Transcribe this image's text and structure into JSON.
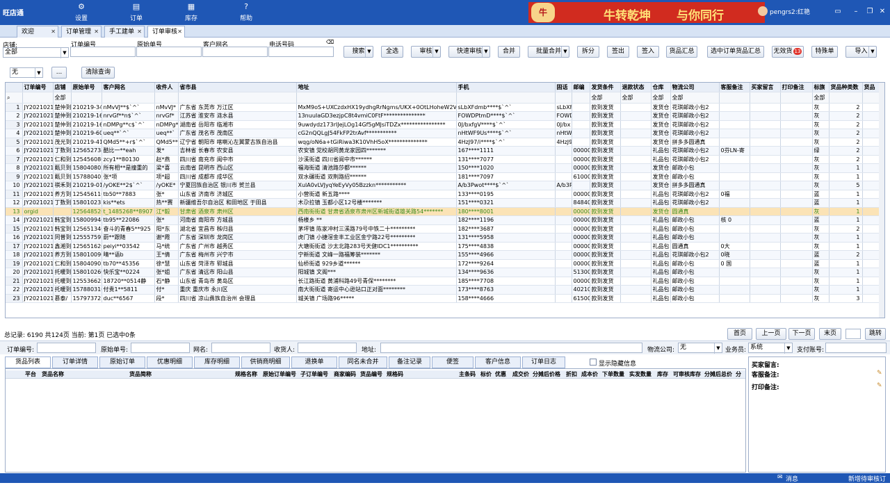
{
  "app": {
    "title": "旺店通",
    "nav": [
      {
        "label": "设置",
        "icon": "gear-icon"
      },
      {
        "label": "订单",
        "icon": "cart-icon"
      },
      {
        "label": "库存",
        "icon": "box-icon"
      },
      {
        "label": "帮助",
        "icon": "help-icon"
      }
    ],
    "banner_left": "牛转乾坤",
    "banner_right": "与你同行",
    "user": "pengrs2:红艳"
  },
  "tabs": [
    "欢迎",
    "订单管理",
    "手工建单",
    "订单审核"
  ],
  "filters": {
    "shop_label": "店铺:",
    "shop_value": "全部",
    "order_no": "订单编号",
    "original_no": "原始单号",
    "customer": "客户网名",
    "phone": "电话号码",
    "flag_value": "无",
    "more": "...",
    "clear": "清除查询"
  },
  "toolbar": [
    {
      "label": "搜索",
      "dd": true
    },
    {
      "label": "全选"
    },
    {
      "label": "审核",
      "dd": true
    },
    {
      "label": "快速审核",
      "dd": true
    },
    {
      "label": "合并"
    },
    {
      "label": "批量合并",
      "dd": true
    },
    {
      "label": "拆分"
    },
    {
      "label": "签出"
    },
    {
      "label": "签入"
    },
    {
      "label": "货品汇总"
    },
    {
      "label": "选中订单货品汇总"
    },
    {
      "label": "无效货",
      "badge": "13"
    },
    {
      "label": "特殊单"
    },
    {
      "label": "导入",
      "dd": true
    }
  ],
  "grid": {
    "headers": [
      "订单编号",
      "店铺",
      "原始单号",
      "客户网名",
      "收件人",
      "省市县",
      "地址",
      "手机",
      "固话",
      "邮编",
      "发货条件",
      "退款状态",
      "仓库",
      "物流公司",
      "客服备注",
      "买家留言",
      "打印备注",
      "标旗",
      "货品种类数",
      "货品"
    ],
    "filter_all": "全部",
    "rows": [
      [
        "1",
        "JY2021021",
        "楚仲到",
        "210219-34",
        "nMvVJ**$`^`",
        "nMvVJ*",
        "广东省 东莞市 万江区",
        "MxM9oS+UXCzdxHX19ydhgRrNgms/UKX+0OtLHoheW2VZJBkw",
        "sLbXFdmb****$`^`",
        "sLbXF",
        "",
        "款到发货",
        "",
        "发货仓",
        "花琪邮政小包2",
        "",
        "",
        "",
        "灰",
        "2"
      ],
      [
        "2",
        "JY2021021",
        "楚仲到",
        "210219-16",
        "nrvGf**n$`^`",
        "nrvGf*",
        "江苏省 淮安市 涟水县",
        "13nuuIaGD3ezjpC8t4vmiC0FtF***************",
        "FOWDPtmD****$`^`",
        "FOWDP",
        "",
        "款到发货",
        "",
        "发货仓",
        "花琪邮政小包2",
        "",
        "",
        "",
        "灰",
        "2"
      ],
      [
        "3",
        "JY2021021",
        "楚仲到",
        "210219-16",
        "nDMPg**c$`^`",
        "nDMPg*",
        "湖南省 岳阳市 临湘市",
        "9uwdydz173rIJejLOg14Gf5gMJsiTDZx****************",
        "0J/bxfgV****$`^`",
        "0J/bx",
        "",
        "款到发货",
        "",
        "发货仓",
        "花琪邮政小包2",
        "",
        "",
        "",
        "灰",
        "2"
      ],
      [
        "4",
        "JY2021021",
        "楚仲到",
        "210219-60",
        "ueq**`^`",
        "ueq**`",
        "广东省 茂名市 茂南区",
        "cG2nQQLgJ54FkFP2trAvf***********",
        "nHtWF9Us****$`^`",
        "nHtWF",
        "",
        "款到发货",
        "",
        "发货仓",
        "花琪邮政小包2",
        "",
        "",
        "",
        "灰",
        "2"
      ],
      [
        "5",
        "JY2021021",
        "茂光到",
        "210219-41",
        "QMd5**+r$`^`",
        "QMd5**",
        "辽宁省 朝阳市 喀喇沁左翼蒙古族自治县",
        "wqg/oN6a+tGiRiwa3K10VhH5oX**************",
        "4HzJ97/i****$`^`",
        "4HzJ9",
        "",
        "款到发货",
        "",
        "发货仓",
        "拼多多圆通真",
        "",
        "",
        "",
        "灰",
        "2"
      ],
      [
        "6",
        "JY2021021",
        "丁数到",
        "125652734",
        "酷比一**eah",
        "发*",
        "吉林省 长春市 农安县",
        "农安镇 党校胡同黄龙家园四*******",
        "167****1111",
        "",
        "00000",
        "款到发货",
        "",
        "礼品包",
        "花琪邮政小包2",
        "0芬LN-寄",
        "",
        "",
        "绿",
        "2"
      ],
      [
        "7",
        "JY2021021",
        "仁和到",
        "125456080",
        "zcy1**80130",
        "赵*燕",
        "四川省 南充市 阆中市",
        "沙溪街道 四川省阆中市******",
        "131****7077",
        "",
        "00000",
        "款到发货",
        "",
        "礼品包",
        "花琪邮政小包2",
        "",
        "",
        "",
        "灰",
        "2"
      ],
      [
        "8",
        "JY2021021",
        "甄贝到",
        "158040802",
        "所有相**是撞重的",
        "梁*喜",
        "云南省 昆明市 西山区",
        "福海街道 清池路莎都******",
        "150****1020",
        "",
        "00000",
        "款到发货",
        "",
        "发货仓",
        "邮政小包",
        "",
        "",
        "",
        "灰",
        "1"
      ],
      [
        "9",
        "JY2021021",
        "甄贝到",
        "157880401",
        "张*项",
        "项*超",
        "四川省 成都市 成华区",
        "双水碾街道 双荆路招******",
        "181****7097",
        "",
        "61000",
        "款到发货",
        "",
        "发货仓",
        "邮政小包",
        "",
        "",
        "",
        "灰",
        "1"
      ],
      [
        "10",
        "JY2021021",
        "祺禾到",
        "210219-01",
        "/yOKE**2$`^`",
        "/yOKE*",
        "宁夏回族自治区 银川市 贺兰县",
        "XulA0vLVJyqYeEyVy05Bzzkn***********",
        "A/b3Pwot****$`^`",
        "A/b3P",
        "",
        "款到发货",
        "",
        "发货仓",
        "拼多多圆通真",
        "",
        "",
        "",
        "灰",
        "5"
      ],
      [
        "11",
        "JY2021021",
        "养方到",
        "125456110",
        "tb50**7883",
        "张*",
        "山东省 济南市 济城区",
        "小营街道 新五路****",
        "133****0195",
        "",
        "00000",
        "款到发货",
        "",
        "礼品包",
        "花琪邮政小包2",
        "0福",
        "",
        "",
        "蓝",
        "1"
      ],
      [
        "12",
        "JY2021021",
        "丁数到",
        "158010231",
        "kis**ets",
        "热**赛",
        "新疆维吾尔自治区 和田地区 于田县",
        "木尕拉镇 玉都小区12号楼*******",
        "151****0321",
        "",
        "84840",
        "款到发货",
        "",
        "礼品包",
        "花琪邮政小包2",
        "",
        "",
        "",
        "蓝",
        "1"
      ],
      [
        "13",
        "orgid",
        "",
        "125648520",
        "t_1485268**8907",
        "江*毅",
        "甘肃省 酒泉市 肃州区",
        "西南街街道 甘肃省酒泉市肃州区新城街道雄关路54*******",
        "180****8001",
        "",
        "00000",
        "款到发货",
        "",
        "发货仓",
        "圆通真",
        "",
        "",
        "",
        "灰",
        "1"
      ],
      [
        "14",
        "JY2021021",
        "韩宝到",
        "158009940",
        "tb95**22086",
        "张*",
        "河南省 南阳市 方城县",
        "杨楼乡 **",
        "182****1196",
        "",
        "00000",
        "款到发货",
        "",
        "礼品包",
        "邮政小包",
        "核 0",
        "",
        "",
        "蓝",
        "1"
      ],
      [
        "15",
        "JY2021021",
        "韩宝到",
        "125651340",
        "奋斗的青春5**925",
        "阳*东",
        "湖北省 宜昌市 秭归县",
        "茅坪镇 陈家冲村三溪路79号中铁二十*********",
        "182****3687",
        "",
        "00000",
        "款到发货",
        "",
        "礼品包",
        "邮政小包",
        "",
        "",
        "",
        "灰",
        "2"
      ],
      [
        "16",
        "JY2021021",
        "同普到",
        "125557597",
        "蔚**跟随",
        "谢*霞",
        "广东省 深圳市 龙岗区",
        "虎门镇 小捷滘金丰工业区金宁路22号*********",
        "131****5958",
        "",
        "00000",
        "款到发货",
        "",
        "礼品包",
        "邮政小包",
        "",
        "",
        "",
        "灰",
        "1"
      ],
      [
        "17",
        "JY2021021",
        "鑫湘到",
        "125651620",
        "peiyi**03542",
        "马*统",
        "广东省 广州市 越秀区",
        "大塘街街道 沙太北路283号天健IDC1**********",
        "175****4838",
        "",
        "00000",
        "款到发货",
        "",
        "礼品包",
        "圆通真",
        "0大",
        "",
        "",
        "灰",
        "1"
      ],
      [
        "18",
        "JY2021021",
        "养方到",
        "158010090",
        "晴**语b",
        "王*倩",
        "广东省 梅州市 兴宁市",
        "宁新街道 文峰一路福筹装*******",
        "155****4966",
        "",
        "00000",
        "款到发货",
        "",
        "礼品包",
        "花琪邮政小包2",
        "0晓",
        "",
        "",
        "蓝",
        "2"
      ],
      [
        "19",
        "JY2021021",
        "仁和到",
        "158040903",
        "tb70**45356",
        "徐*慧",
        "山东省 菏泽市 郓城县",
        "仙桥街道 929乡道******",
        "172****9264",
        "",
        "00000",
        "款到发货",
        "",
        "礼品包",
        "邮政小包",
        "0 国",
        "",
        "",
        "蓝",
        "1"
      ],
      [
        "20",
        "JY2021021",
        "托暖到",
        "158010260",
        "快乐宝**0224",
        "张*姐",
        "广东省 清远市 阳山县",
        "阳城镇 文阁***",
        "134****9636",
        "",
        "51300",
        "款到发货",
        "",
        "礼品包",
        "邮政小包",
        "",
        "",
        "",
        "灰",
        "1"
      ],
      [
        "21",
        "JY2021021",
        "托暖到",
        "125536622",
        "18720**0514静",
        "石*静",
        "山东省 青岛市 黄岛区",
        "长江路街道 黄浦科路49号青保********",
        "185****7708",
        "",
        "00000",
        "款到发货",
        "",
        "礼品包",
        "邮政小包",
        "",
        "",
        "",
        "灰",
        "1"
      ],
      [
        "22",
        "JY2021021",
        "托暖到",
        "157880310",
        "付贵1**5811",
        "付*",
        "重庆 重庆市 永川区",
        "南大街街道 寄运中心逊站口正对面********",
        "173****8763",
        "",
        "40210",
        "款到发货",
        "",
        "礼品包",
        "邮政小包",
        "",
        "",
        "",
        "灰",
        "1"
      ],
      [
        "23",
        "JY2021021",
        "慕泰/",
        "157973721",
        "duc**6567",
        "段*",
        "四川省 凉山彝族自治州 会理县",
        "城关镇 广场路96*****",
        "158****4666",
        "",
        "61500",
        "款到发货",
        "",
        "礼品包",
        "邮政小包",
        "",
        "",
        "",
        "灰",
        "3"
      ]
    ]
  },
  "pager": {
    "summary": "总记录: 6190  共124页  当前: 第1页  已选中0条",
    "first": "首页",
    "prev": "上一页",
    "next": "下一页",
    "last": "末页",
    "jump": "跳转"
  },
  "detail_filter": {
    "order_no": "订单编号:",
    "original_no": "原始单号:",
    "customer": "网名:",
    "receiver": "收货人:",
    "address": "地址:",
    "logistics": "物流公司:",
    "logistics_value": "无",
    "staff": "业务员:",
    "staff_value": "系统",
    "pay_account": "支付账号:"
  },
  "bottom_tabs": [
    "货品列表",
    "订单详情",
    "原始订单",
    "优惠明细",
    "库存明细",
    "供销商明细",
    "退换单",
    "同名未合并",
    "备注记录",
    "便签",
    "客户信息",
    "订单日志"
  ],
  "show_hidden": "显示隐藏信息",
  "bottom_headers": [
    "平台",
    "货品名称",
    "货品简称",
    "规格名称",
    "原始订单编号",
    "子订单编号",
    "商家编码",
    "货品编号",
    "规格码",
    "主条码",
    "标价",
    "优惠",
    "成交价",
    "分摊后价格",
    "折扣",
    "成本价",
    "下单数量",
    "实发数量",
    "库存",
    "可审核库存",
    "分摊后总价",
    "分"
  ],
  "side": {
    "buyer_msg": "买家留言:",
    "cs_note": "客服备注:",
    "print_note": "打印备注:"
  },
  "statusbar": {
    "message": "消息",
    "new_order": "新增待审核订单"
  }
}
